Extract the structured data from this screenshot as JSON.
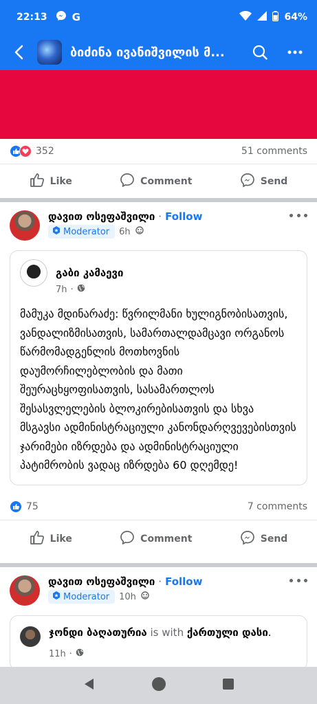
{
  "status_bar": {
    "time": "22:13",
    "battery": "64%",
    "icons": [
      "messenger-icon",
      "google-icon",
      "wifi-icon",
      "signal-icon",
      "battery-icon"
    ]
  },
  "app_bar": {
    "title": "ბიძინა ივანიშვილის მ...",
    "icons": [
      "back-arrow-icon",
      "search-icon",
      "more-icon"
    ]
  },
  "post1_footer": {
    "reaction_count": "352",
    "comments": "51 comments",
    "actions": {
      "like": "Like",
      "comment": "Comment",
      "send": "Send"
    }
  },
  "post2": {
    "author": "დავით ოსეფაშვილი",
    "separator": "·",
    "follow": "Follow",
    "badge": "Moderator",
    "time": "6h",
    "shared": {
      "author": "გაბი კამაევი",
      "time": "7h",
      "text": "მამუკა მდინარაძე: წვრილმანი ხულიგნობისათვის, ვანდალიზმისათვის, სამართალდამცავი ორგანოს წარმომადგენლის მოთხოვნის დაუმორჩილებლობის და მათი შეურაცხყოფისათვის, სასამართლოს შესასვლელების ბლოკირებისათვის და სხვა მსგავსი ადმინისტრაციული კანონდარღვევებისთვის ჯარიმები იზრდება და ადმინისტრაციული პატიმრობის ვადაც იზრდება 60 დღემდე!"
    },
    "reaction_count": "75",
    "comments": "7 comments",
    "actions": {
      "like": "Like",
      "comment": "Comment",
      "send": "Send"
    }
  },
  "post3": {
    "author": "დავით ოსეფაშვილი",
    "separator": "·",
    "follow": "Follow",
    "badge": "Moderator",
    "time": "10h",
    "shared": {
      "author": "ჯონდი ბაღათურია",
      "with_text": "is with",
      "with_target": "ქართული დასი",
      "period": ".",
      "time": "11h"
    }
  },
  "colors": {
    "brand_blue": "#1877f2",
    "red_media": "#e5073d",
    "muted": "#65676b"
  }
}
